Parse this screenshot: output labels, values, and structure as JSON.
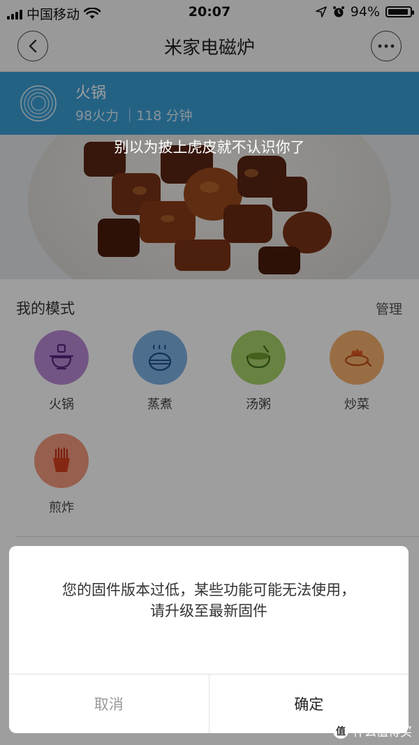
{
  "status_bar": {
    "carrier": "中国移动",
    "time": "20:07",
    "battery": "94%",
    "battery_level": 0.94
  },
  "nav": {
    "title": "米家电磁炉"
  },
  "banner": {
    "title": "火锅",
    "subtitle": "98火力 ｜118 分钟"
  },
  "hero": {
    "caption": "别以为披上虎皮就不认识你了"
  },
  "modes_section": {
    "title": "我的模式",
    "manage": "管理",
    "modes": [
      {
        "label": "火锅",
        "icon": "hotpot-icon",
        "color": "#b98ad6"
      },
      {
        "label": "蒸煮",
        "icon": "steamer-icon",
        "color": "#7fb2e6"
      },
      {
        "label": "汤粥",
        "icon": "soup-bowl-icon",
        "color": "#a8d26a"
      },
      {
        "label": "炒菜",
        "icon": "stir-fry-icon",
        "color": "#f6b16f"
      },
      {
        "label": "煎炸",
        "icon": "fries-icon",
        "color": "#f49a7c"
      }
    ]
  },
  "dialog": {
    "line1": "您的固件版本过低，某些功能可能无法使用，",
    "line2": "请升级至最新固件",
    "cancel": "取消",
    "confirm": "确定"
  },
  "watermark": {
    "badge": "值",
    "text": "什么值得买"
  }
}
